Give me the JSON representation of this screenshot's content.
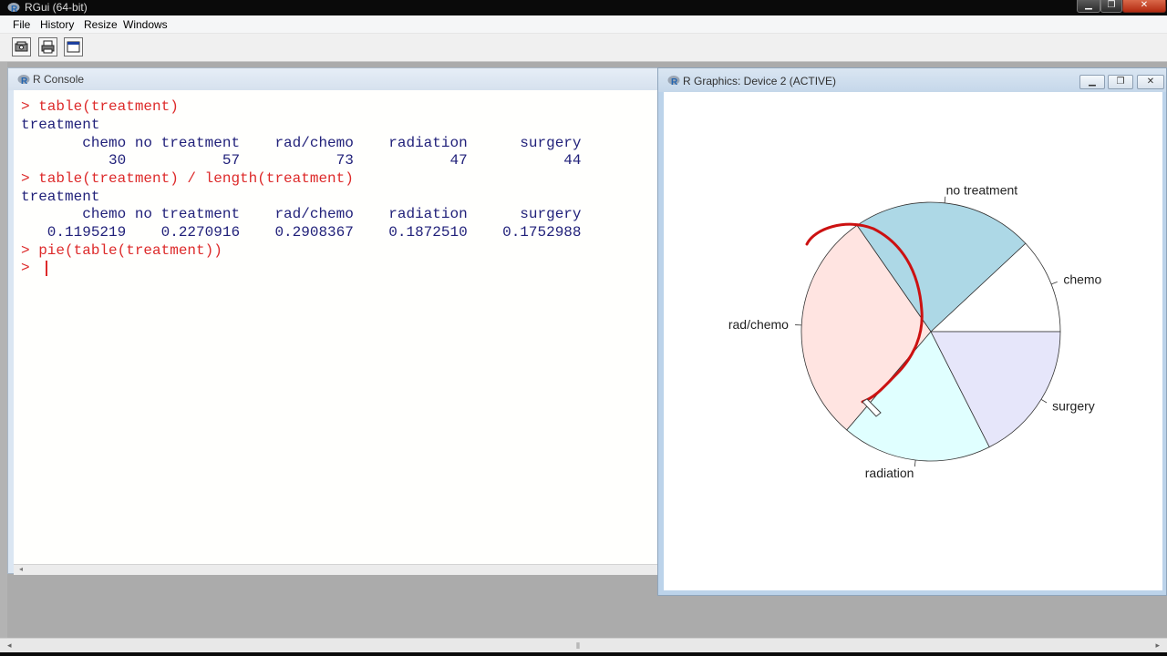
{
  "app": {
    "title": "RGui (64-bit)",
    "controls": {
      "minimize": "▁",
      "maximize": "❐",
      "close": "✕"
    }
  },
  "menu": {
    "items": [
      "File",
      "History",
      "Resize",
      "Windows"
    ]
  },
  "toolbar": {
    "buttons": [
      "open-script-icon",
      "print-icon",
      "window-icon"
    ]
  },
  "console": {
    "title": "R Console",
    "lines": [
      {
        "kind": "input",
        "text": "> table(treatment)"
      },
      {
        "kind": "output",
        "text": "treatment"
      },
      {
        "kind": "output",
        "text": "       chemo no treatment    rad/chemo    radiation      surgery"
      },
      {
        "kind": "output",
        "text": "          30           57           73           47           44"
      },
      {
        "kind": "input",
        "text": "> table(treatment) / length(treatment)"
      },
      {
        "kind": "output",
        "text": "treatment"
      },
      {
        "kind": "output",
        "text": "       chemo no treatment    rad/chemo    radiation      surgery"
      },
      {
        "kind": "output",
        "text": "   0.1195219    0.2270916    0.2908367    0.1872510    0.1752988"
      },
      {
        "kind": "input",
        "text": "> pie(table(treatment))"
      },
      {
        "kind": "input",
        "text": "> "
      }
    ]
  },
  "graphics": {
    "title": "R Graphics: Device 2 (ACTIVE)",
    "controls": {
      "minimize": "▁",
      "maximize": "❐",
      "close": "✕"
    }
  },
  "chart_data": {
    "type": "pie",
    "title": "",
    "categories": [
      "chemo",
      "no treatment",
      "rad/chemo",
      "radiation",
      "surgery"
    ],
    "values": [
      30,
      57,
      73,
      47,
      44
    ],
    "colors": [
      "#ffffff",
      "#add8e6",
      "#ffe4e1",
      "#e0ffff",
      "#e6e6fa"
    ],
    "start_angle_deg": 0,
    "direction": "counterclockwise",
    "annotation_color": "#cc1111"
  },
  "colors": {
    "console_input": "#dd2a2a",
    "console_output": "#21217a",
    "title_bar": "#0a0a0a",
    "mdi_background": "#ababab"
  }
}
